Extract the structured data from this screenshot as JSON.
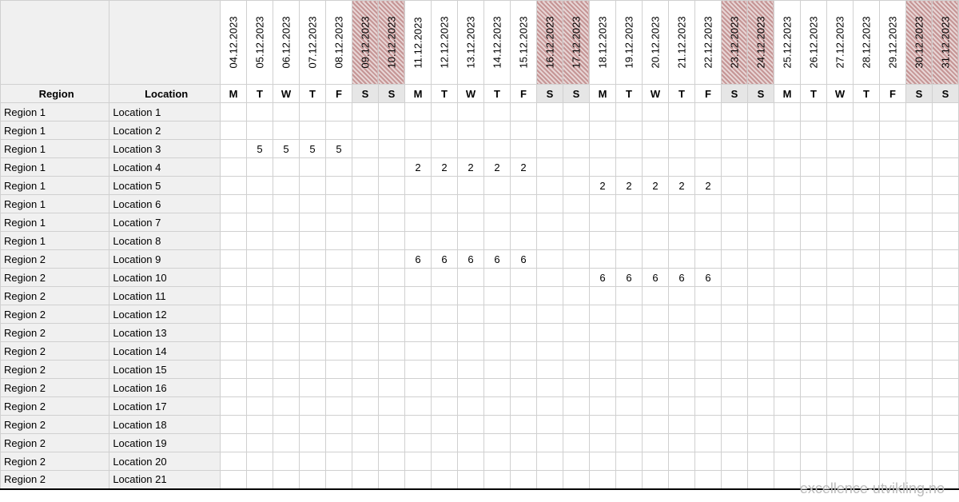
{
  "headers": {
    "region": "Region",
    "location": "Location"
  },
  "dates": [
    {
      "date": "04.12.2023",
      "dow": "M",
      "weekend": false,
      "weekStart": false
    },
    {
      "date": "05.12.2023",
      "dow": "T",
      "weekend": false,
      "weekStart": false
    },
    {
      "date": "06.12.2023",
      "dow": "W",
      "weekend": false,
      "weekStart": false
    },
    {
      "date": "07.12.2023",
      "dow": "T",
      "weekend": false,
      "weekStart": false
    },
    {
      "date": "08.12.2023",
      "dow": "F",
      "weekend": false,
      "weekStart": false
    },
    {
      "date": "09.12.2023",
      "dow": "S",
      "weekend": true,
      "weekStart": false
    },
    {
      "date": "10.12.2023",
      "dow": "S",
      "weekend": true,
      "weekStart": false
    },
    {
      "date": "11.12.2023",
      "dow": "M",
      "weekend": false,
      "weekStart": false
    },
    {
      "date": "12.12.2023",
      "dow": "T",
      "weekend": false,
      "weekStart": false
    },
    {
      "date": "13.12.2023",
      "dow": "W",
      "weekend": false,
      "weekStart": false
    },
    {
      "date": "14.12.2023",
      "dow": "T",
      "weekend": false,
      "weekStart": false
    },
    {
      "date": "15.12.2023",
      "dow": "F",
      "weekend": false,
      "weekStart": false
    },
    {
      "date": "16.12.2023",
      "dow": "S",
      "weekend": true,
      "weekStart": false
    },
    {
      "date": "17.12.2023",
      "dow": "S",
      "weekend": true,
      "weekStart": false
    },
    {
      "date": "18.12.2023",
      "dow": "M",
      "weekend": false,
      "weekStart": true
    },
    {
      "date": "19.12.2023",
      "dow": "T",
      "weekend": false,
      "weekStart": false
    },
    {
      "date": "20.12.2023",
      "dow": "W",
      "weekend": false,
      "weekStart": false
    },
    {
      "date": "21.12.2023",
      "dow": "T",
      "weekend": false,
      "weekStart": false
    },
    {
      "date": "22.12.2023",
      "dow": "F",
      "weekend": false,
      "weekStart": false
    },
    {
      "date": "23.12.2023",
      "dow": "S",
      "weekend": true,
      "weekStart": false
    },
    {
      "date": "24.12.2023",
      "dow": "S",
      "weekend": true,
      "weekStart": false
    },
    {
      "date": "25.12.2023",
      "dow": "M",
      "weekend": false,
      "weekStart": false
    },
    {
      "date": "26.12.2023",
      "dow": "T",
      "weekend": false,
      "weekStart": false
    },
    {
      "date": "27.12.2023",
      "dow": "W",
      "weekend": false,
      "weekStart": false
    },
    {
      "date": "28.12.2023",
      "dow": "T",
      "weekend": false,
      "weekStart": false
    },
    {
      "date": "29.12.2023",
      "dow": "F",
      "weekend": false,
      "weekStart": false
    },
    {
      "date": "30.12.2023",
      "dow": "S",
      "weekend": true,
      "weekStart": false
    },
    {
      "date": "31.12.2023",
      "dow": "S",
      "weekend": true,
      "weekStart": false
    }
  ],
  "rows": [
    {
      "region": "Region 1",
      "location": "Location 1",
      "values": {}
    },
    {
      "region": "Region 1",
      "location": "Location 2",
      "values": {}
    },
    {
      "region": "Region 1",
      "location": "Location 3",
      "values": {
        "1": "5",
        "2": "5",
        "3": "5",
        "4": "5"
      }
    },
    {
      "region": "Region 1",
      "location": "Location 4",
      "values": {
        "7": "2",
        "8": "2",
        "9": "2",
        "10": "2",
        "11": "2"
      }
    },
    {
      "region": "Region 1",
      "location": "Location 5",
      "values": {
        "14": "2",
        "15": "2",
        "16": "2",
        "17": "2",
        "18": "2"
      }
    },
    {
      "region": "Region 1",
      "location": "Location 6",
      "values": {}
    },
    {
      "region": "Region 1",
      "location": "Location 7",
      "values": {}
    },
    {
      "region": "Region 1",
      "location": "Location 8",
      "values": {}
    },
    {
      "region": "Region 2",
      "location": "Location 9",
      "values": {
        "7": "6",
        "8": "6",
        "9": "6",
        "10": "6",
        "11": "6"
      }
    },
    {
      "region": "Region 2",
      "location": "Location 10",
      "values": {
        "14": "6",
        "15": "6",
        "16": "6",
        "17": "6",
        "18": "6"
      }
    },
    {
      "region": "Region 2",
      "location": "Location 11",
      "values": {}
    },
    {
      "region": "Region 2",
      "location": "Location 12",
      "values": {}
    },
    {
      "region": "Region 2",
      "location": "Location 13",
      "values": {}
    },
    {
      "region": "Region 2",
      "location": "Location 14",
      "values": {}
    },
    {
      "region": "Region 2",
      "location": "Location 15",
      "values": {}
    },
    {
      "region": "Region 2",
      "location": "Location 16",
      "values": {}
    },
    {
      "region": "Region 2",
      "location": "Location 17",
      "values": {}
    },
    {
      "region": "Region 2",
      "location": "Location 18",
      "values": {}
    },
    {
      "region": "Region 2",
      "location": "Location 19",
      "values": {}
    },
    {
      "region": "Region 2",
      "location": "Location 20",
      "values": {}
    },
    {
      "region": "Region 2",
      "location": "Location 21",
      "values": {}
    }
  ],
  "watermark": "excellence-utvikling.no"
}
